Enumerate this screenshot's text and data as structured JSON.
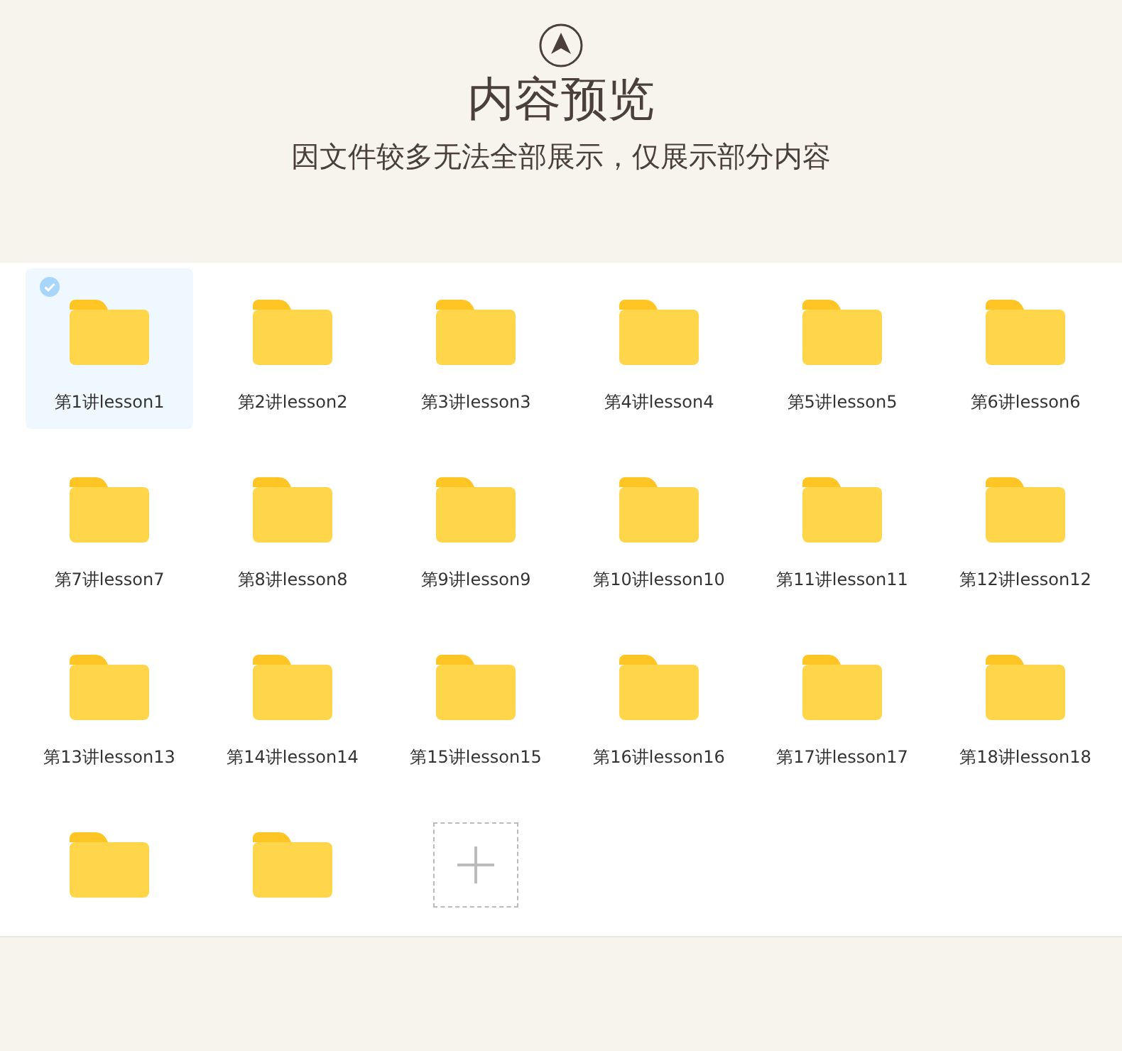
{
  "header": {
    "title": "内容预览",
    "subtitle": "因文件较多无法全部展示，仅展示部分内容"
  },
  "folders": [
    {
      "label": "第1讲lesson1",
      "selected": true
    },
    {
      "label": "第2讲lesson2",
      "selected": false
    },
    {
      "label": "第3讲lesson3",
      "selected": false
    },
    {
      "label": "第4讲lesson4",
      "selected": false
    },
    {
      "label": "第5讲lesson5",
      "selected": false
    },
    {
      "label": "第6讲lesson6",
      "selected": false
    },
    {
      "label": "第7讲lesson7",
      "selected": false
    },
    {
      "label": "第8讲lesson8",
      "selected": false
    },
    {
      "label": "第9讲lesson9",
      "selected": false
    },
    {
      "label": "第10讲lesson10",
      "selected": false
    },
    {
      "label": "第11讲lesson11",
      "selected": false
    },
    {
      "label": "第12讲lesson12",
      "selected": false
    },
    {
      "label": "第13讲lesson13",
      "selected": false
    },
    {
      "label": "第14讲lesson14",
      "selected": false
    },
    {
      "label": "第15讲lesson15",
      "selected": false
    },
    {
      "label": "第16讲lesson16",
      "selected": false
    },
    {
      "label": "第17讲lesson17",
      "selected": false
    },
    {
      "label": "第18讲lesson18",
      "selected": false
    },
    {
      "selected": false
    },
    {
      "selected": false
    }
  ]
}
